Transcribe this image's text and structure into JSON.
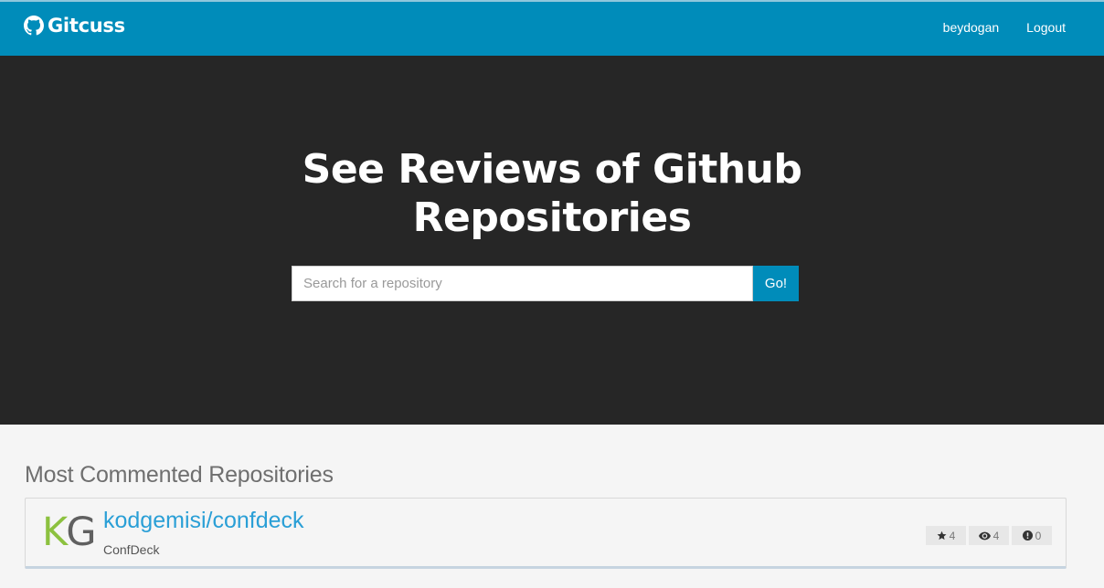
{
  "navbar": {
    "brand": "Gitcuss",
    "brand_icon": "github-icon",
    "links": [
      "beydogan",
      "Logout"
    ],
    "background": "#008cba"
  },
  "hero": {
    "title_line1": "See Reviews of Github",
    "title_line2": "Repositories",
    "search": {
      "placeholder": "Search for a repository",
      "value": ""
    },
    "go_label": "Go!",
    "background": "#262626"
  },
  "section": {
    "title": "Most Commented Repositories"
  },
  "repos": [
    {
      "logo_k": "K",
      "logo_g": "G",
      "name": "kodgemisi/confdeck",
      "description": "ConfDeck",
      "stars": "4",
      "watchers": "4",
      "issues": "0",
      "star_icon": "star-icon",
      "watch_icon": "eye-icon",
      "issue_icon": "exclamation-circle-icon"
    }
  ]
}
